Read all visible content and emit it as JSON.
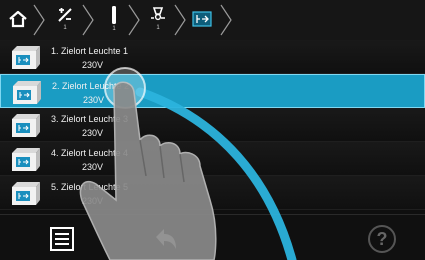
{
  "breadcrumb": [
    {
      "icon": "home-icon",
      "number": ""
    },
    {
      "icon": "group-icon",
      "number": "1"
    },
    {
      "icon": "circuit-icon",
      "number": "1"
    },
    {
      "icon": "luminaire-icon",
      "number": "1"
    },
    {
      "icon": "exit-sign-icon",
      "number": ""
    }
  ],
  "list": {
    "items": [
      {
        "title": "1. Zielort Leuchte 1",
        "voltage": "230V",
        "selected": false
      },
      {
        "title": "2. Zielort Leuchte 2",
        "voltage": "230V",
        "selected": true
      },
      {
        "title": "3. Zielort Leuchte 3",
        "voltage": "230V",
        "selected": false
      },
      {
        "title": "4. Zielort Leuchte 4",
        "voltage": "230V",
        "selected": false
      },
      {
        "title": "5. Zielort Leuchte 5",
        "voltage": "230V",
        "selected": false
      }
    ]
  },
  "toolbar": {
    "menu_icon": "list-menu-icon",
    "back_icon": "back-arrow-icon",
    "help_label": "?"
  },
  "colors": {
    "selection": "#1a9cc3",
    "selection_border": "#7fd8f2",
    "accent": "#2bb3dd"
  },
  "overlay": {
    "icon": "pointing-hand-icon"
  }
}
